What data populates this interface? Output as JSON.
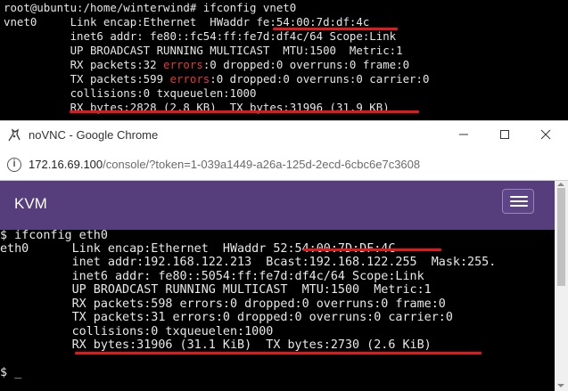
{
  "top_terminal": {
    "prompt": "root@ubuntu:/home/winterwind# ifconfig vnet0",
    "lines": [
      "vnet0     Link encap:Ethernet  HWaddr fe:54:00:7d:df:4c",
      "          inet6 addr: fe80::fc54:ff:fe7d:df4c/64 Scope:Link",
      "          UP BROADCAST RUNNING MULTICAST  MTU:1500  Metric:1",
      "          RX packets:32 errors:0 dropped:0 overruns:0 frame:0",
      "          TX packets:599 errors:0 dropped:0 overruns:0 carrier:0",
      "          collisions:0 txqueuelen:1000",
      "          RX bytes:2828 (2.8 KB)  TX bytes:31996 (31.9 KB)"
    ],
    "rx_packets_prefix": "          RX packets:32 ",
    "tx_packets_prefix": "          TX packets:599 ",
    "errors_word": "errors",
    "rx_packets_suffix": ":0 dropped:0 overruns:0 frame:0",
    "tx_packets_suffix": ":0 dropped:0 overruns:0 carrier:0"
  },
  "browser": {
    "window_title": "noVNC - Google Chrome",
    "url_host": "172.16.69.100",
    "url_path": "/console/?token=1-039a1449-a26a-125d-2ecd-6cbc6e7c3608",
    "brand": "KVM"
  },
  "vm_console": {
    "lines": [
      "$ ifconfig eth0",
      "eth0      Link encap:Ethernet  HWaddr 52:54:00:7D:DF:4C",
      "          inet addr:192.168.122.213  Bcast:192.168.122.255  Mask:255.",
      "          inet6 addr: fe80::5054:ff:fe7d:df4c/64 Scope:Link",
      "          UP BROADCAST RUNNING MULTICAST  MTU:1500  Metric:1",
      "          RX packets:598 errors:0 dropped:0 overruns:0 frame:0",
      "          TX packets:31 errors:0 dropped:0 overruns:0 carrier:0",
      "          collisions:0 txqueuelen:1000",
      "          RX bytes:31906 (31.1 KiB)  TX bytes:2730 (2.6 KiB)",
      "",
      "$ _"
    ]
  },
  "colors": {
    "highlight_underline": "#e8151b",
    "error_text": "#e03a3a",
    "kvm_navbar": "#563d7c"
  }
}
